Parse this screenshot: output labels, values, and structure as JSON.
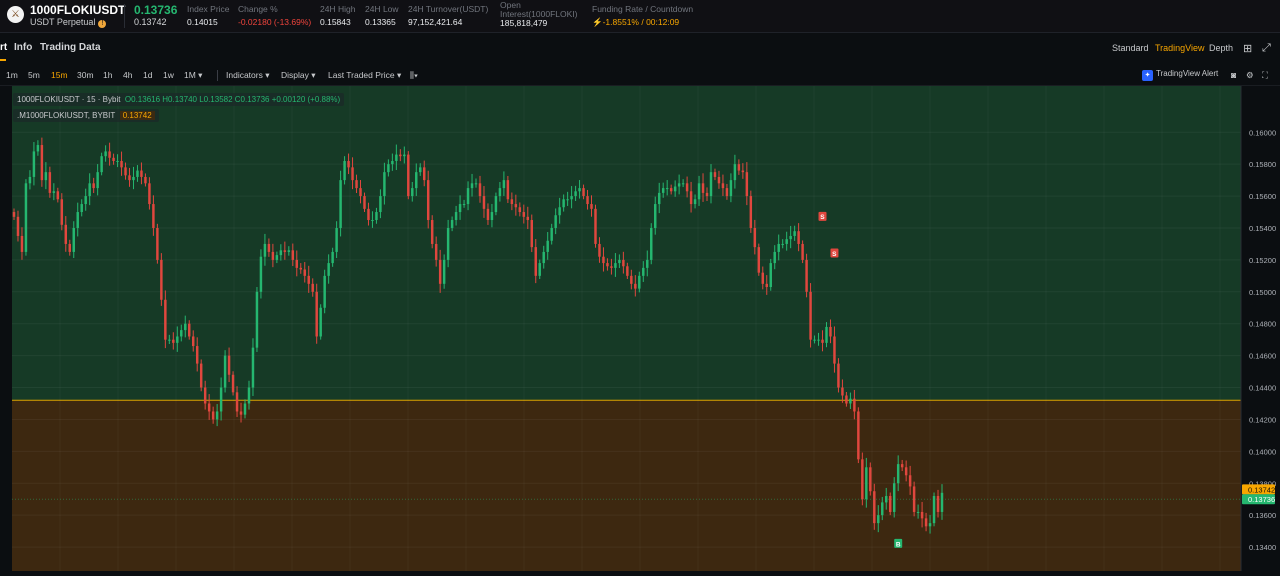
{
  "header": {
    "symbol": "1000FLOKIUSDT",
    "subtitle": "USDT Perpetual",
    "logo_icon": "floki-logo-icon",
    "last_price": "0.13736",
    "mark_price": "0.13742",
    "stats": [
      {
        "label": "Index Price",
        "value": "0.14015",
        "tone": "normal"
      },
      {
        "label": "Change %",
        "value": "-0.02180 (-13.69%)",
        "tone": "red"
      },
      {
        "label": "24H High",
        "value": "0.15843",
        "tone": "normal"
      },
      {
        "label": "24H Low",
        "value": "0.13365",
        "tone": "normal"
      },
      {
        "label": "24H Turnover(USDT)",
        "value": "97,152,421.64",
        "tone": "normal"
      },
      {
        "label": "Open Interest(1000FLOKI)",
        "value": "185,818,479",
        "tone": "normal"
      },
      {
        "label": "Funding Rate / Countdown",
        "value": "-1.8551% / 00:12:09",
        "tone": "orange"
      }
    ]
  },
  "tabs": {
    "left": [
      "rt",
      "Info",
      "Trading Data"
    ],
    "right": [
      "Standard",
      "TradingView",
      "Depth"
    ],
    "right_active": "TradingView"
  },
  "toolbar": {
    "timeframes": [
      "1m",
      "5m",
      "15m",
      "30m",
      "1h",
      "4h",
      "1d",
      "1w",
      "1M ▾"
    ],
    "active_timeframe": "15m",
    "menus": [
      "Indicators ▾",
      "Display ▾",
      "Last Traded Price ▾"
    ],
    "alert_label": "TradingView Alert"
  },
  "legend": {
    "line1_prefix": "1000FLOKIUSDT · 15 · Bybit",
    "ohlc": "O0.13616  H0.13740  L0.13582  C0.13736  +0.00120 (+0.88%)",
    "line2_prefix": ".M1000FLOKIUSDT, BYBIT",
    "line2_value": "0.13742"
  },
  "chart_data": {
    "type": "candlestick",
    "y_ticks": [
      "0.16000",
      "0.15800",
      "0.15600",
      "0.15400",
      "0.15200",
      "0.15000",
      "0.14800",
      "0.14600",
      "0.14400",
      "0.14200",
      "0.14000",
      "0.13800",
      "0.13600",
      "0.13400"
    ],
    "ylim": [
      0.1325,
      0.1629
    ],
    "zone_split": 0.1432,
    "zone_colors": {
      "upper": "#163a26",
      "lower": "#3d2810"
    },
    "up_color": "#25b770",
    "down_color": "#e0473e",
    "closes": [
      0.1547,
      0.1535,
      0.1525,
      0.1568,
      0.1572,
      0.1588,
      0.1592,
      0.157,
      0.1575,
      0.1562,
      0.1563,
      0.1558,
      0.1542,
      0.153,
      0.1525,
      0.154,
      0.155,
      0.1555,
      0.156,
      0.1568,
      0.1565,
      0.1575,
      0.1585,
      0.1588,
      0.1584,
      0.1582,
      0.1582,
      0.1578,
      0.1573,
      0.157,
      0.1572,
      0.1576,
      0.1572,
      0.1568,
      0.1555,
      0.154,
      0.152,
      0.1495,
      0.147,
      0.147,
      0.1468,
      0.1472,
      0.1476,
      0.148,
      0.1472,
      0.1466,
      0.1455,
      0.144,
      0.143,
      0.1425,
      0.142,
      0.1425,
      0.144,
      0.146,
      0.1448,
      0.1437,
      0.1425,
      0.1423,
      0.143,
      0.144,
      0.1465,
      0.15,
      0.1522,
      0.153,
      0.1525,
      0.152,
      0.1523,
      0.1526,
      0.1525,
      0.1526,
      0.152,
      0.1515,
      0.1514,
      0.151,
      0.1505,
      0.15,
      0.1472,
      0.149,
      0.151,
      0.1518,
      0.1525,
      0.154,
      0.157,
      0.1582,
      0.1578,
      0.157,
      0.1565,
      0.156,
      0.1552,
      0.1545,
      0.1545,
      0.155,
      0.156,
      0.1575,
      0.158,
      0.1582,
      0.1586,
      0.1585,
      0.1586,
      0.156,
      0.1565,
      0.1575,
      0.1578,
      0.157,
      0.1545,
      0.153,
      0.152,
      0.1505,
      0.152,
      0.154,
      0.1545,
      0.155,
      0.1555,
      0.1555,
      0.1565,
      0.1568,
      0.1568,
      0.156,
      0.1552,
      0.1545,
      0.155,
      0.156,
      0.1565,
      0.157,
      0.1558,
      0.1555,
      0.1553,
      0.155,
      0.1547,
      0.1545,
      0.1528,
      0.151,
      0.1518,
      0.1525,
      0.1532,
      0.154,
      0.1548,
      0.1553,
      0.1558,
      0.1558,
      0.156,
      0.1563,
      0.1565,
      0.156,
      0.1555,
      0.1552,
      0.153,
      0.1522,
      0.1518,
      0.1516,
      0.1515,
      0.1518,
      0.152,
      0.1516,
      0.151,
      0.1505,
      0.1502,
      0.151,
      0.1515,
      0.152,
      0.154,
      0.1555,
      0.1562,
      0.1565,
      0.1565,
      0.1563,
      0.1566,
      0.1568,
      0.1568,
      0.1563,
      0.1555,
      0.1558,
      0.1568,
      0.1562,
      0.156,
      0.1575,
      0.1572,
      0.1568,
      0.1565,
      0.156,
      0.157,
      0.158,
      0.1576,
      0.1575,
      0.156,
      0.154,
      0.1528,
      0.1512,
      0.1505,
      0.1503,
      0.1518,
      0.1525,
      0.153,
      0.153,
      0.1533,
      0.1535,
      0.1538,
      0.153,
      0.152,
      0.15,
      0.147,
      0.147,
      0.147,
      0.1468,
      0.1478,
      0.1472,
      0.1455,
      0.144,
      0.1435,
      0.143,
      0.1433,
      0.1425,
      0.1395,
      0.137,
      0.139,
      0.1375,
      0.1355,
      0.136,
      0.1368,
      0.1372,
      0.1362,
      0.138,
      0.1392,
      0.139,
      0.1385,
      0.1378,
      0.1362,
      0.1362,
      0.1358,
      0.1353,
      0.1355,
      0.1372,
      0.1362,
      0.1374
    ],
    "markers": [
      {
        "label": "S",
        "tone": "sell",
        "index": 203,
        "price": 0.1547
      },
      {
        "label": "S",
        "tone": "sell",
        "index": 206,
        "price": 0.1524
      },
      {
        "label": "B",
        "tone": "buy",
        "index": 222,
        "price": 0.1342
      }
    ],
    "price_labels": [
      {
        "text": "0.13742",
        "price": 0.13762,
        "tone": "orange"
      },
      {
        "text": "0.13736",
        "price": 0.137,
        "tone": "green"
      }
    ]
  }
}
